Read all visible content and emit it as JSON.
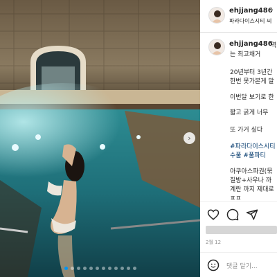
{
  "post_header": {
    "username": "ehjjang486",
    "separator": "•",
    "location": "파라다이스시티 씨"
  },
  "caption": {
    "username": "ehjjang486",
    "line1_rest": "역",
    "line2": "는 최고채거",
    "line3": "20년부터 3년간",
    "line4": "한번 못가본게 말",
    "line5": "이번달 보기로 한",
    "line6": "짧고 굵게 너무",
    "line7": "또 가거 싶다",
    "tags1": "#파라다이스시티",
    "tags2": "수풀 #풀파티",
    "line8": "아쿠아스파권(묶",
    "line9": "질방+사우나 까",
    "line10": "계란 까지 제대로",
    "line11": "ㅍㅍ"
  },
  "date": "2월 12",
  "comment": {
    "placeholder": "댓글 달기..."
  },
  "carousel": {
    "total_slides": 12,
    "active_index": 0
  },
  "colors": {
    "link": "#00376b",
    "accent": "#0095f6"
  },
  "icons": [
    "heart-icon",
    "comment-icon",
    "share-icon",
    "emoji-icon",
    "chevron-right-icon"
  ]
}
